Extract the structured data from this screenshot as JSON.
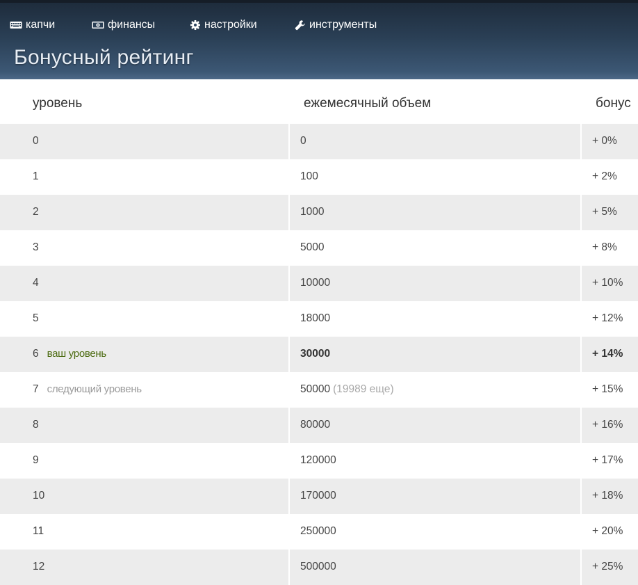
{
  "nav": {
    "items": [
      {
        "label": "капчи",
        "icon": "keyboard-icon"
      },
      {
        "label": "финансы",
        "icon": "money-icon"
      },
      {
        "label": "настройки",
        "icon": "gear-icon"
      },
      {
        "label": "инструменты",
        "icon": "wrench-icon"
      }
    ]
  },
  "page": {
    "title": "Бонусный рейтинг"
  },
  "table": {
    "headers": {
      "level": "уровень",
      "volume": "ежемесячный объем",
      "bonus": "бонус"
    },
    "rows": [
      {
        "level": "0",
        "volume": "0",
        "bonus": "+ 0%"
      },
      {
        "level": "1",
        "volume": "100",
        "bonus": "+ 2%"
      },
      {
        "level": "2",
        "volume": "1000",
        "bonus": "+ 5%"
      },
      {
        "level": "3",
        "volume": "5000",
        "bonus": "+ 8%"
      },
      {
        "level": "4",
        "volume": "10000",
        "bonus": "+ 10%"
      },
      {
        "level": "5",
        "volume": "18000",
        "bonus": "+ 12%"
      },
      {
        "level": "6",
        "note": "ваш уровень",
        "volume": "30000",
        "bonus": "+ 14%",
        "current": true
      },
      {
        "level": "7",
        "note": "следующий уровень",
        "volume": "50000",
        "extra": "(19989 еще)",
        "bonus": "+ 15%",
        "next": true
      },
      {
        "level": "8",
        "volume": "80000",
        "bonus": "+ 16%"
      },
      {
        "level": "9",
        "volume": "120000",
        "bonus": "+ 17%"
      },
      {
        "level": "10",
        "volume": "170000",
        "bonus": "+ 18%"
      },
      {
        "level": "11",
        "volume": "250000",
        "bonus": "+ 20%"
      },
      {
        "level": "12",
        "volume": "500000",
        "bonus": "+ 25%"
      }
    ]
  },
  "colors": {
    "header_dark": "#1e2c3c",
    "header_light": "#4d6887",
    "row_alt": "#ececec",
    "current_level_note": "#4d6c12",
    "next_level_note": "#9a9a9a"
  }
}
